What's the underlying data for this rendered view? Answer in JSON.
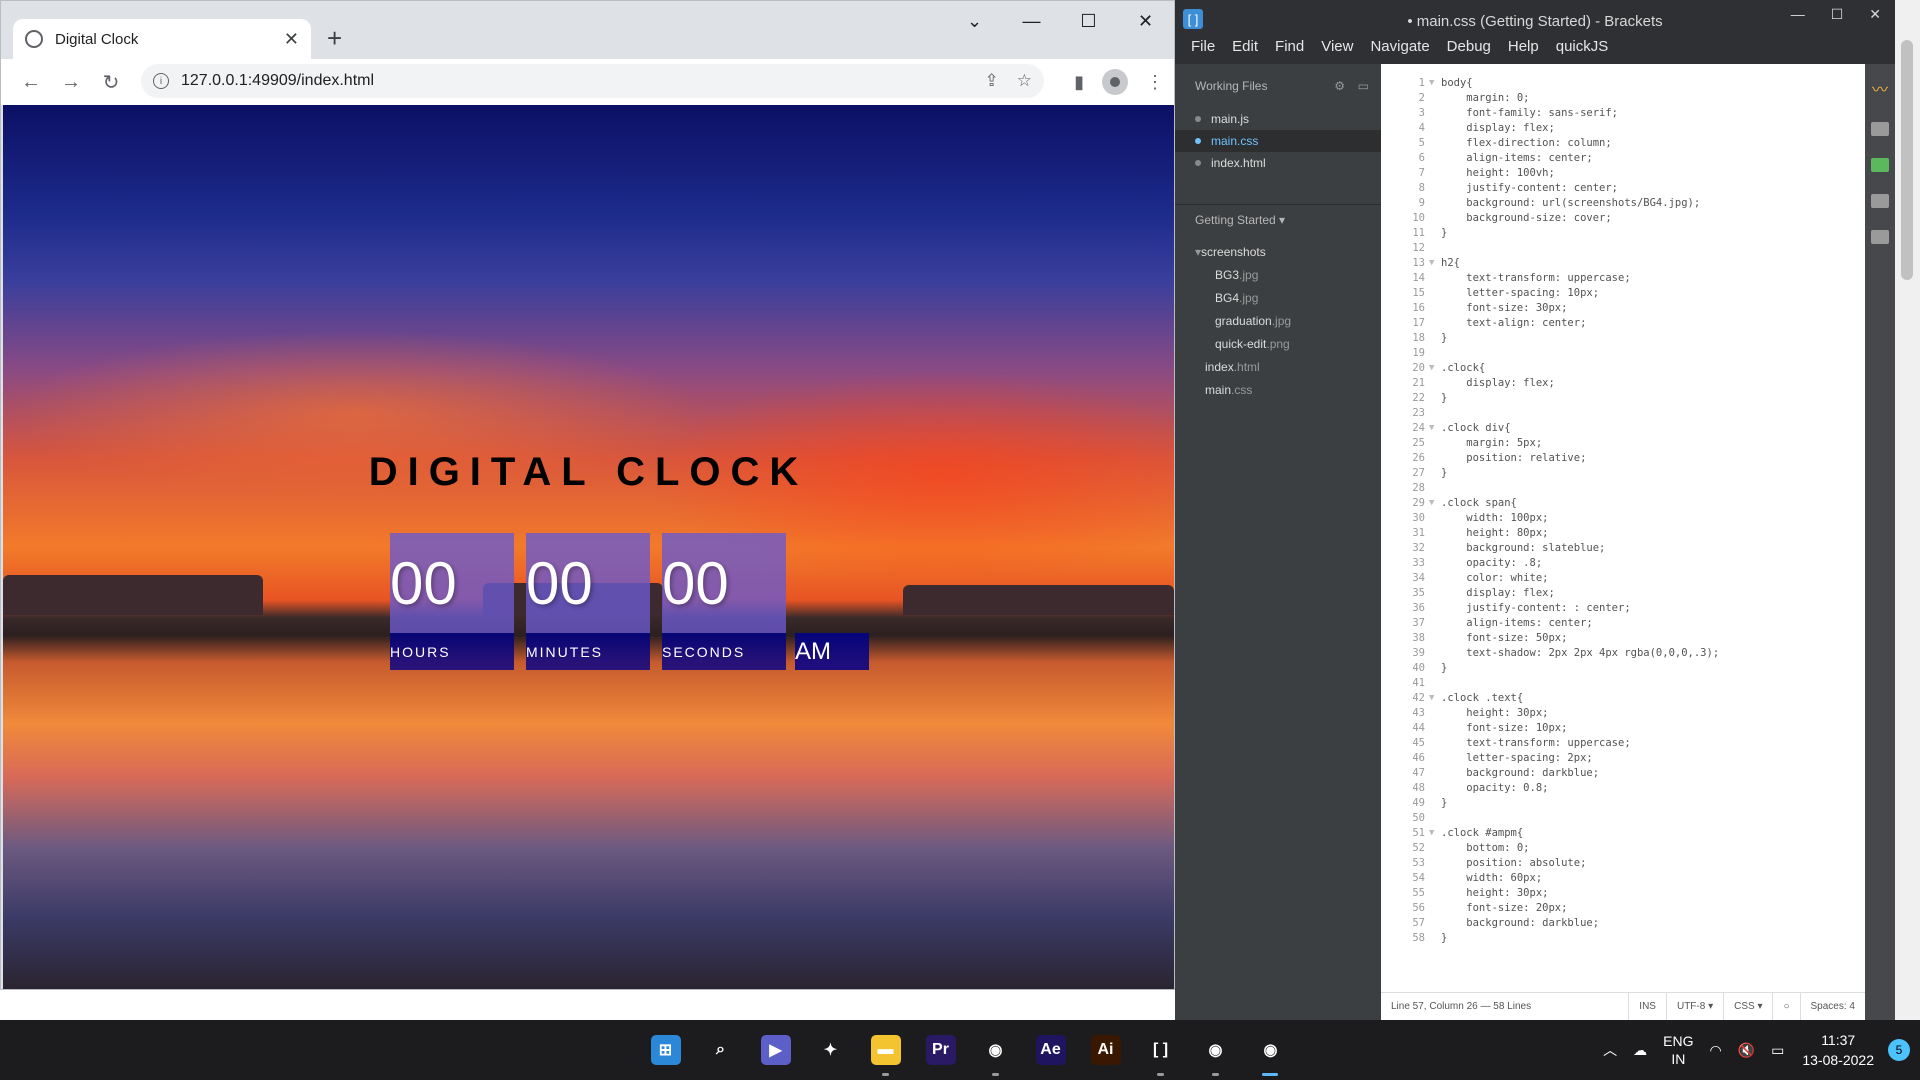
{
  "browser": {
    "tab_title": "Digital Clock",
    "url": "127.0.0.1:49909/index.html"
  },
  "page": {
    "heading": "DIGITAL CLOCK",
    "hours": "00",
    "minutes": "00",
    "seconds": "00",
    "hours_label": "HOURS",
    "minutes_label": "MINUTES",
    "seconds_label": "SECONDS",
    "ampm": "AM"
  },
  "editor": {
    "window_title": "• main.css (Getting Started) - Brackets",
    "menu": [
      "File",
      "Edit",
      "Find",
      "View",
      "Navigate",
      "Debug",
      "Help",
      "quickJS"
    ],
    "working_files_label": "Working Files",
    "working_files": [
      {
        "name": "main.js",
        "selected": false
      },
      {
        "name": "main.css",
        "selected": true
      },
      {
        "name": "index.html",
        "selected": false
      }
    ],
    "project_label": "Getting Started ▾",
    "tree": [
      {
        "kind": "folder",
        "base": "screenshots",
        "ext": ""
      },
      {
        "kind": "sub",
        "base": "BG3",
        "ext": ".jpg"
      },
      {
        "kind": "sub",
        "base": "BG4",
        "ext": ".jpg"
      },
      {
        "kind": "sub",
        "base": "graduation",
        "ext": ".jpg"
      },
      {
        "kind": "sub",
        "base": "quick-edit",
        "ext": ".png"
      },
      {
        "kind": "top",
        "base": "index",
        "ext": ".html"
      },
      {
        "kind": "top",
        "base": "main",
        "ext": ".css"
      }
    ],
    "code_lines": [
      "body{",
      "    margin: 0;",
      "    font-family: sans-serif;",
      "    display: flex;",
      "    flex-direction: column;",
      "    align-items: center;",
      "    height: 100vh;",
      "    justify-content: center;",
      "    background: url(screenshots/BG4.jpg);",
      "    background-size: cover;",
      "}",
      "",
      "h2{",
      "    text-transform: uppercase;",
      "    letter-spacing: 10px;",
      "    font-size: 30px;",
      "    text-align: center;",
      "}",
      "",
      ".clock{",
      "    display: flex;",
      "}",
      "",
      ".clock div{",
      "    margin: 5px;",
      "    position: relative;",
      "}",
      "",
      ".clock span{",
      "    width: 100px;",
      "    height: 80px;",
      "    background: slateblue;",
      "    opacity: .8;",
      "    color: white;",
      "    display: flex;",
      "    justify-content: : center;",
      "    align-items: center;",
      "    font-size: 50px;",
      "    text-shadow: 2px 2px 4px rgba(0,0,0,.3);",
      "}",
      "",
      ".clock .text{",
      "    height: 30px;",
      "    font-size: 10px;",
      "    text-transform: uppercase;",
      "    letter-spacing: 2px;",
      "    background: darkblue;",
      "    opacity: 0.8;",
      "}",
      "",
      ".clock #ampm{",
      "    bottom: 0;",
      "    position: absolute;",
      "    width: 60px;",
      "    height: 30px;",
      "    font-size: 20px;",
      "    background: darkblue;",
      "}"
    ],
    "status": {
      "position": "Line 57, Column 26 — 58 Lines",
      "mode": "INS",
      "encoding": "UTF-8 ▾",
      "language": "CSS ▾",
      "spaces": "Spaces: 4"
    }
  },
  "taskbar": {
    "apps": [
      {
        "name": "windows-start",
        "label": "⊞",
        "color": "#2b88d8"
      },
      {
        "name": "search",
        "label": "⌕",
        "color": "#1c1c1e"
      },
      {
        "name": "teams-chat",
        "label": "▶",
        "color": "#5b5fc7"
      },
      {
        "name": "zbrush",
        "label": "✦",
        "color": "#1c1c1e"
      },
      {
        "name": "file-explorer",
        "label": "▬",
        "color": "#f4c430"
      },
      {
        "name": "premiere-pro",
        "label": "Pr",
        "color": "#2a1a66"
      },
      {
        "name": "chrome-profile",
        "label": "◉",
        "color": "#1c1c1e"
      },
      {
        "name": "after-effects",
        "label": "Ae",
        "color": "#1f1460"
      },
      {
        "name": "illustrator",
        "label": "Ai",
        "color": "#3a1800"
      },
      {
        "name": "brackets",
        "label": "[ ]",
        "color": "#1c1c1e"
      },
      {
        "name": "chrome-alt",
        "label": "◉",
        "color": "#1c1c1e"
      },
      {
        "name": "chrome",
        "label": "◉",
        "color": "#1c1c1e"
      }
    ],
    "lang_top": "ENG",
    "lang_bottom": "IN",
    "time": "11:37",
    "date": "13-08-2022",
    "notifications": "5"
  }
}
